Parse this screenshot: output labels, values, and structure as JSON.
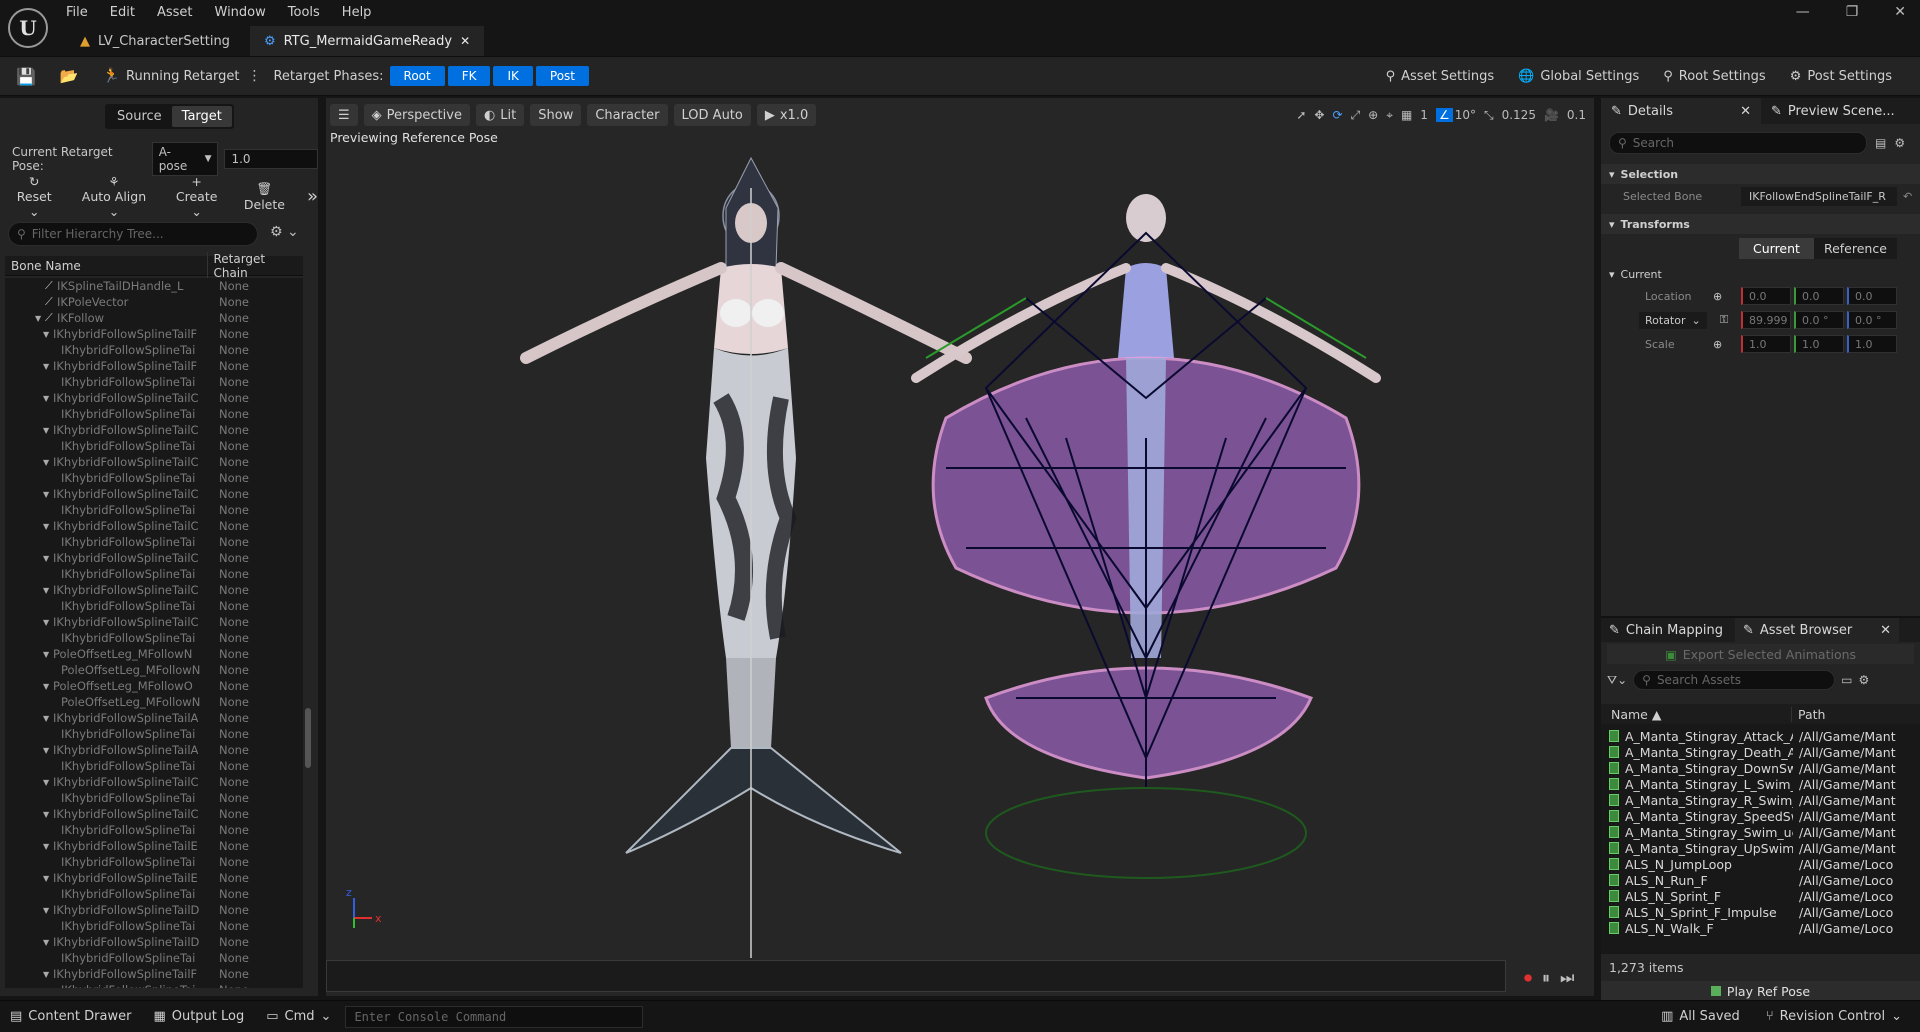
{
  "menubar": {
    "items": [
      "File",
      "Edit",
      "Asset",
      "Window",
      "Tools",
      "Help"
    ]
  },
  "tabs": [
    {
      "label": "LV_CharacterSetting",
      "active": false
    },
    {
      "label": "RTG_MermaidGameReady",
      "active": true
    }
  ],
  "toolbar": {
    "running_retarget": "Running Retarget",
    "phases_label": "Retarget Phases:",
    "phases": [
      "Root",
      "FK",
      "IK",
      "Post"
    ],
    "settings": [
      "Asset Settings",
      "Global Settings",
      "Root Settings",
      "Post Settings"
    ]
  },
  "left": {
    "source_tab": "Source",
    "target_tab": "Target",
    "pose_label": "Current Retarget Pose:",
    "pose_value": "A-pose",
    "blend_value": "1.0",
    "actions": [
      "Reset",
      "Auto Align",
      "Create",
      "Delete"
    ],
    "filter_placeholder": "Filter Hierarchy Tree...",
    "col_bone": "Bone Name",
    "col_chain": "Retarget Chain",
    "tree": [
      {
        "name": "IKSplineTailDHandle_L",
        "chain": "None",
        "indent": 3,
        "expand": false,
        "bone": true
      },
      {
        "name": "IKPoleVector",
        "chain": "None",
        "indent": 3,
        "expand": false,
        "bone": true
      },
      {
        "name": "IKFollow",
        "chain": "None",
        "indent": 3,
        "expand": true,
        "bone": true
      },
      {
        "name": "IKhybridFollowSplineTailF",
        "chain": "None",
        "indent": 4,
        "expand": true
      },
      {
        "name": "IKhybridFollowSplineTai",
        "chain": "None",
        "indent": 5,
        "expand": false
      },
      {
        "name": "IKhybridFollowSplineTailF",
        "chain": "None",
        "indent": 4,
        "expand": true
      },
      {
        "name": "IKhybridFollowSplineTai",
        "chain": "None",
        "indent": 5,
        "expand": false
      },
      {
        "name": "IKhybridFollowSplineTailC",
        "chain": "None",
        "indent": 4,
        "expand": true
      },
      {
        "name": "IKhybridFollowSplineTai",
        "chain": "None",
        "indent": 5,
        "expand": false
      },
      {
        "name": "IKhybridFollowSplineTailC",
        "chain": "None",
        "indent": 4,
        "expand": true
      },
      {
        "name": "IKhybridFollowSplineTai",
        "chain": "None",
        "indent": 5,
        "expand": false
      },
      {
        "name": "IKhybridFollowSplineTailC",
        "chain": "None",
        "indent": 4,
        "expand": true
      },
      {
        "name": "IKhybridFollowSplineTai",
        "chain": "None",
        "indent": 5,
        "expand": false
      },
      {
        "name": "IKhybridFollowSplineTailC",
        "chain": "None",
        "indent": 4,
        "expand": true
      },
      {
        "name": "IKhybridFollowSplineTai",
        "chain": "None",
        "indent": 5,
        "expand": false
      },
      {
        "name": "IKhybridFollowSplineTailC",
        "chain": "None",
        "indent": 4,
        "expand": true
      },
      {
        "name": "IKhybridFollowSplineTai",
        "chain": "None",
        "indent": 5,
        "expand": false
      },
      {
        "name": "IKhybridFollowSplineTailC",
        "chain": "None",
        "indent": 4,
        "expand": true
      },
      {
        "name": "IKhybridFollowSplineTai",
        "chain": "None",
        "indent": 5,
        "expand": false
      },
      {
        "name": "IKhybridFollowSplineTailC",
        "chain": "None",
        "indent": 4,
        "expand": true
      },
      {
        "name": "IKhybridFollowSplineTai",
        "chain": "None",
        "indent": 5,
        "expand": false
      },
      {
        "name": "IKhybridFollowSplineTailC",
        "chain": "None",
        "indent": 4,
        "expand": true
      },
      {
        "name": "IKhybridFollowSplineTai",
        "chain": "None",
        "indent": 5,
        "expand": false
      },
      {
        "name": "PoleOffsetLeg_MFollowN",
        "chain": "None",
        "indent": 4,
        "expand": true
      },
      {
        "name": "PoleOffsetLeg_MFollowN",
        "chain": "None",
        "indent": 5,
        "expand": false
      },
      {
        "name": "PoleOffsetLeg_MFollowO",
        "chain": "None",
        "indent": 4,
        "expand": true
      },
      {
        "name": "PoleOffsetLeg_MFollowN",
        "chain": "None",
        "indent": 5,
        "expand": false
      },
      {
        "name": "IKhybridFollowSplineTailA",
        "chain": "None",
        "indent": 4,
        "expand": true
      },
      {
        "name": "IKhybridFollowSplineTai",
        "chain": "None",
        "indent": 5,
        "expand": false
      },
      {
        "name": "IKhybridFollowSplineTailA",
        "chain": "None",
        "indent": 4,
        "expand": true
      },
      {
        "name": "IKhybridFollowSplineTai",
        "chain": "None",
        "indent": 5,
        "expand": false
      },
      {
        "name": "IKhybridFollowSplineTailC",
        "chain": "None",
        "indent": 4,
        "expand": true
      },
      {
        "name": "IKhybridFollowSplineTai",
        "chain": "None",
        "indent": 5,
        "expand": false
      },
      {
        "name": "IKhybridFollowSplineTailC",
        "chain": "None",
        "indent": 4,
        "expand": true
      },
      {
        "name": "IKhybridFollowSplineTai",
        "chain": "None",
        "indent": 5,
        "expand": false
      },
      {
        "name": "IKhybridFollowSplineTailE",
        "chain": "None",
        "indent": 4,
        "expand": true
      },
      {
        "name": "IKhybridFollowSplineTai",
        "chain": "None",
        "indent": 5,
        "expand": false
      },
      {
        "name": "IKhybridFollowSplineTailE",
        "chain": "None",
        "indent": 4,
        "expand": true
      },
      {
        "name": "IKhybridFollowSplineTai",
        "chain": "None",
        "indent": 5,
        "expand": false
      },
      {
        "name": "IKhybridFollowSplineTailD",
        "chain": "None",
        "indent": 4,
        "expand": true
      },
      {
        "name": "IKhybridFollowSplineTai",
        "chain": "None",
        "indent": 5,
        "expand": false
      },
      {
        "name": "IKhybridFollowSplineTailD",
        "chain": "None",
        "indent": 4,
        "expand": true
      },
      {
        "name": "IKhybridFollowSplineTai",
        "chain": "None",
        "indent": 5,
        "expand": false
      },
      {
        "name": "IKhybridFollowSplineTailF",
        "chain": "None",
        "indent": 4,
        "expand": true
      },
      {
        "name": "IKhybridFollowSplineTai",
        "chain": "None",
        "indent": 5,
        "expand": false
      }
    ]
  },
  "viewport": {
    "perspective": "Perspective",
    "lit": "Lit",
    "show": "Show",
    "character": "Character",
    "lod": "LOD Auto",
    "speed": "x1.0",
    "preview_text": "Previewing Reference Pose",
    "grid_value": "1",
    "angle_value": "10°",
    "scale_value": "0.125",
    "camera_value": "0.1"
  },
  "details": {
    "tab": "Details",
    "preview_tab": "Preview Scene...",
    "search_placeholder": "Search",
    "selection_header": "Selection",
    "selected_bone_label": "Selected Bone",
    "selected_bone_value": "IKFollowEndSplineTailF_R",
    "transforms_header": "Transforms",
    "current_btn": "Current",
    "reference_btn": "Reference",
    "current_header": "Current",
    "location_label": "Location",
    "rotator_label": "Rotator",
    "scale_label": "Scale",
    "location": [
      "0.0",
      "0.0",
      "0.0"
    ],
    "rotator": [
      "89.999",
      "0.0 °",
      "0.0 °"
    ],
    "scale": [
      "1.0",
      "1.0",
      "1.0"
    ]
  },
  "assets": {
    "chain_tab": "Chain Mapping",
    "browser_tab": "Asset Browser",
    "export_label": "Export Selected Animations",
    "search_placeholder": "Search Assets",
    "col_name": "Name",
    "col_path": "Path",
    "items": [
      {
        "name": "A_Manta_Stingray_Attack_Al",
        "path": "/All/Game/Mant"
      },
      {
        "name": "A_Manta_Stingray_Death_Ar",
        "path": "/All/Game/Mant"
      },
      {
        "name": "A_Manta_Stingray_DownSwi",
        "path": "/All/Game/Mant"
      },
      {
        "name": "A_Manta_Stingray_L_Swim_(",
        "path": "/All/Game/Mant"
      },
      {
        "name": "A_Manta_Stingray_R_Swim_",
        "path": "/All/Game/Mant"
      },
      {
        "name": "A_Manta_Stingray_SpeedSw",
        "path": "/All/Game/Mant"
      },
      {
        "name": "A_Manta_Stingray_Swim_ue",
        "path": "/All/Game/Mant"
      },
      {
        "name": "A_Manta_Stingray_UpSwim_",
        "path": "/All/Game/Mant"
      },
      {
        "name": "ALS_N_JumpLoop",
        "path": "/All/Game/Loco"
      },
      {
        "name": "ALS_N_Run_F",
        "path": "/All/Game/Loco"
      },
      {
        "name": "ALS_N_Sprint_F",
        "path": "/All/Game/Loco"
      },
      {
        "name": "ALS_N_Sprint_F_Impulse",
        "path": "/All/Game/Loco"
      },
      {
        "name": "ALS_N_Walk_F",
        "path": "/All/Game/Loco"
      }
    ],
    "count": "1,273 items",
    "play_ref": "Play Ref Pose"
  },
  "status": {
    "content_drawer": "Content Drawer",
    "output_log": "Output Log",
    "cmd": "Cmd",
    "console_placeholder": "Enter Console Command",
    "saved": "All Saved",
    "revision": "Revision Control"
  },
  "colors": {
    "accent": "#0070e0",
    "panel": "#242424",
    "viewport_bg": "#262626"
  }
}
